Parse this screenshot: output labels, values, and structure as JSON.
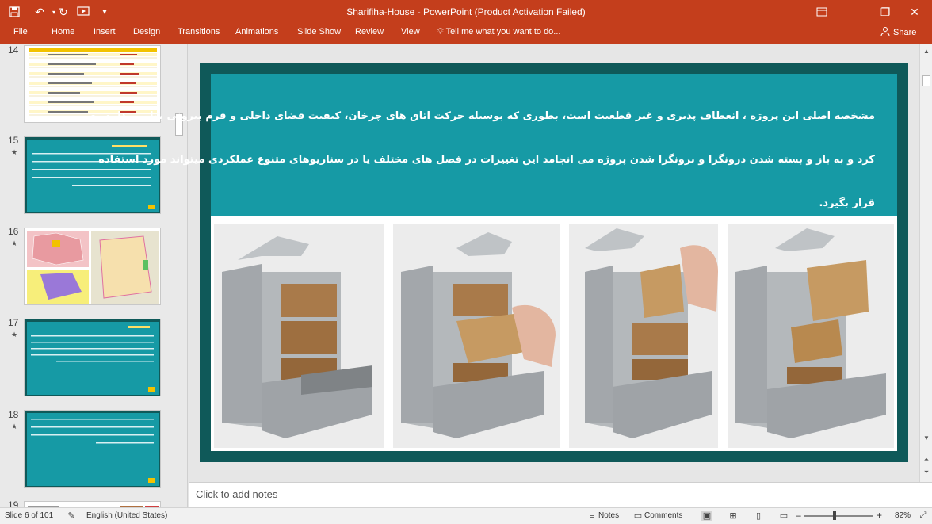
{
  "window": {
    "title": "Sharifiha-House - PowerPoint (Product Activation Failed)",
    "icons": [
      "save-icon",
      "undo-icon",
      "redo-icon",
      "start-from-beginning-icon",
      "touch-mode-icon",
      "customize-qat-icon"
    ],
    "controls": [
      "ribbon-display-icon",
      "minimize-icon",
      "restore-icon",
      "close-icon"
    ]
  },
  "ribbon": {
    "tabs": [
      "File",
      "Home",
      "Insert",
      "Design",
      "Transitions",
      "Animations",
      "Slide Show",
      "Review",
      "View"
    ],
    "tell_me": "Tell me what you want to do...",
    "share": "Share"
  },
  "thumbnails": [
    {
      "num": "14",
      "star": "",
      "style": "table"
    },
    {
      "num": "15",
      "star": "★",
      "style": "teal"
    },
    {
      "num": "16",
      "star": "★",
      "style": "maps"
    },
    {
      "num": "17",
      "star": "★",
      "style": "teal"
    },
    {
      "num": "18",
      "star": "★",
      "style": "teal"
    },
    {
      "num": "19",
      "star": "",
      "style": "partial"
    }
  ],
  "slide": {
    "lines": [
      "مشخصه اصلی این پروژه ، انعطاف پذیری و غیر قطعیت است، بطوری که بوسیله حرکت اتاق های چرخان، کیفیت فضای داخلی و فرم بیرونی بطور مداوم تغییر",
      "کرد و به باز و بسته شدن درونگرا و برونگرا شدن پروژه می انجامد این تغییرات در فصل های مختلف یا در سناریوهای متنوع عملکردی میتواند مورد استفاده",
      "قرار بگیرد."
    ],
    "colors": {
      "frame": "#0f5959",
      "textbox": "#169aa5",
      "text": "#ffffff"
    }
  },
  "notes": {
    "placeholder": "Click to add notes"
  },
  "status": {
    "slide": "Slide 6 of 101",
    "language": "English (United States)",
    "notes": "Notes",
    "comments": "Comments",
    "zoom": "82%"
  }
}
